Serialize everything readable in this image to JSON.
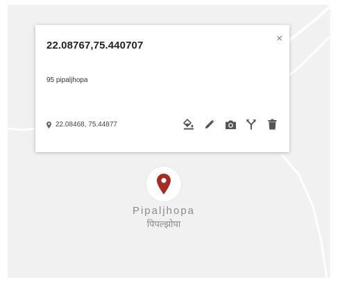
{
  "popup": {
    "title": "22.08767,75.440707",
    "close_label": "×",
    "description": "95 pipaljhopa",
    "coordinates": "22.08468, 75.44877",
    "actions": [
      {
        "icon": "paint-bucket-icon"
      },
      {
        "icon": "pencil-icon"
      },
      {
        "icon": "camera-icon"
      },
      {
        "icon": "directions-icon"
      },
      {
        "icon": "trash-icon"
      }
    ]
  },
  "map": {
    "place_name_latin": "Pipaljhopa",
    "place_name_devanagari": "पिपल्झोपा",
    "marker_icon": "map-pin-icon",
    "colors": {
      "marker": "#a52a22",
      "background": "#f1f1f1",
      "road": "#ffffff"
    }
  }
}
